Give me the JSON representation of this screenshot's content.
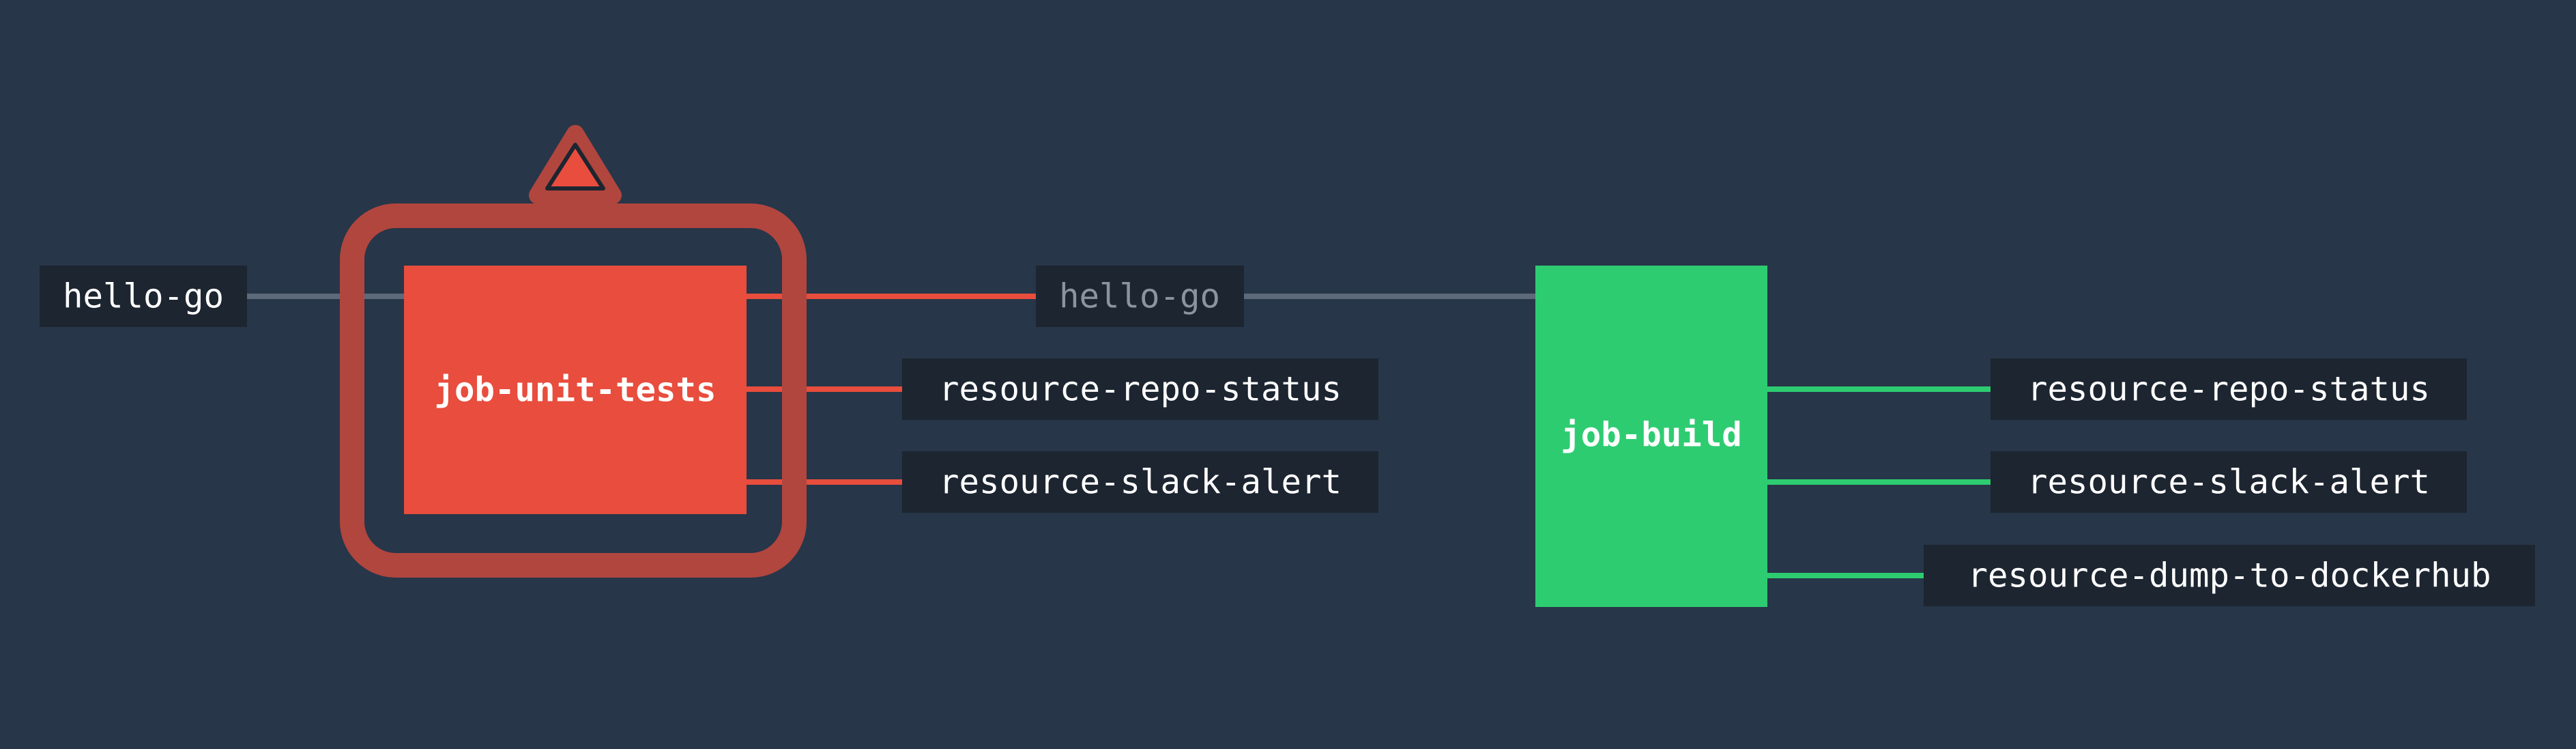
{
  "colors": {
    "background": "#273649",
    "resource_box": "#1c2530",
    "failed_job": "#e84d3d",
    "failed_halo": "#b1463e",
    "succeeded_job": "#2ecc71",
    "inactive_edge": "#5c6a79",
    "resource_text": "#ffffff",
    "dim_resource_text": "#8b949e"
  },
  "icons": {
    "failure_marker": "warning-triangle-icon"
  },
  "inputs": {
    "hello_go_left": "hello-go",
    "hello_go_middle": "hello-go"
  },
  "jobs": {
    "unit_tests": {
      "name": "job-unit-tests",
      "status": "failed"
    },
    "build": {
      "name": "job-build",
      "status": "succeeded"
    }
  },
  "outputs": {
    "unit_tests": [
      "resource-repo-status",
      "resource-slack-alert"
    ],
    "build": [
      "resource-repo-status",
      "resource-slack-alert",
      "resource-dump-to-dockerhub"
    ]
  }
}
